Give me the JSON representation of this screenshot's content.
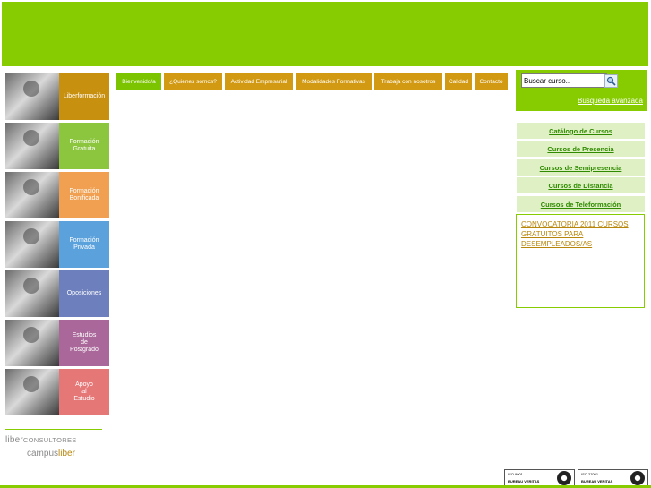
{
  "colors": {
    "brand_green": "#86cc00",
    "light_green": "#dff0c4",
    "link_green": "#2f8a00",
    "nav_orange": "#d29a12",
    "nav_active": "#7cc300",
    "link_gold": "#b8860b"
  },
  "sidebar_tiles": [
    {
      "label": "Liberformación",
      "color": "#c8900f"
    },
    {
      "label": "Formación\nGratuita",
      "color": "#8cc63f"
    },
    {
      "label": "Formación\nBonificada",
      "color": "#f0a050"
    },
    {
      "label": "Formación\nPrivada",
      "color": "#5ba2dd"
    },
    {
      "label": "Oposiciones",
      "color": "#6d80bd"
    },
    {
      "label": "Estudios\nde\nPostgrado",
      "color": "#a9679a"
    },
    {
      "label": "Apoyo\nal\nEstudio",
      "color": "#e57777"
    }
  ],
  "brand": {
    "liber_bold": "liber",
    "consultores": "CONSULTORES",
    "campus": "campus",
    "campus_liber": "liber"
  },
  "nav": [
    {
      "label": "Bienvenido/a",
      "active": true
    },
    {
      "label": "¿Quiénes somos?"
    },
    {
      "label": "Actividad Empresarial"
    },
    {
      "label": "Modalidades Formativas"
    },
    {
      "label": "Trabaja con nosotros"
    },
    {
      "label": "Calidad"
    },
    {
      "label": "Contacto"
    }
  ],
  "search": {
    "value": "Buscar curso..",
    "icon": "magnifier-icon",
    "advanced_link": "Búsqueda avanzada"
  },
  "catalog": [
    "Catálogo de Cursos",
    "Cursos de Presencia",
    "Cursos de Semipresencia",
    "Cursos de Distancia",
    "Cursos de Teleformación"
  ],
  "news": {
    "link": "CONVOCATORIA 2011 CURSOS GRATUITOS PARA DESEMPLEADOS/AS"
  },
  "certifications": [
    {
      "code": "ISO 9001",
      "org": "BUREAU VERITAS"
    },
    {
      "code": "ISO 27001",
      "org": "BUREAU VERITAS"
    }
  ]
}
